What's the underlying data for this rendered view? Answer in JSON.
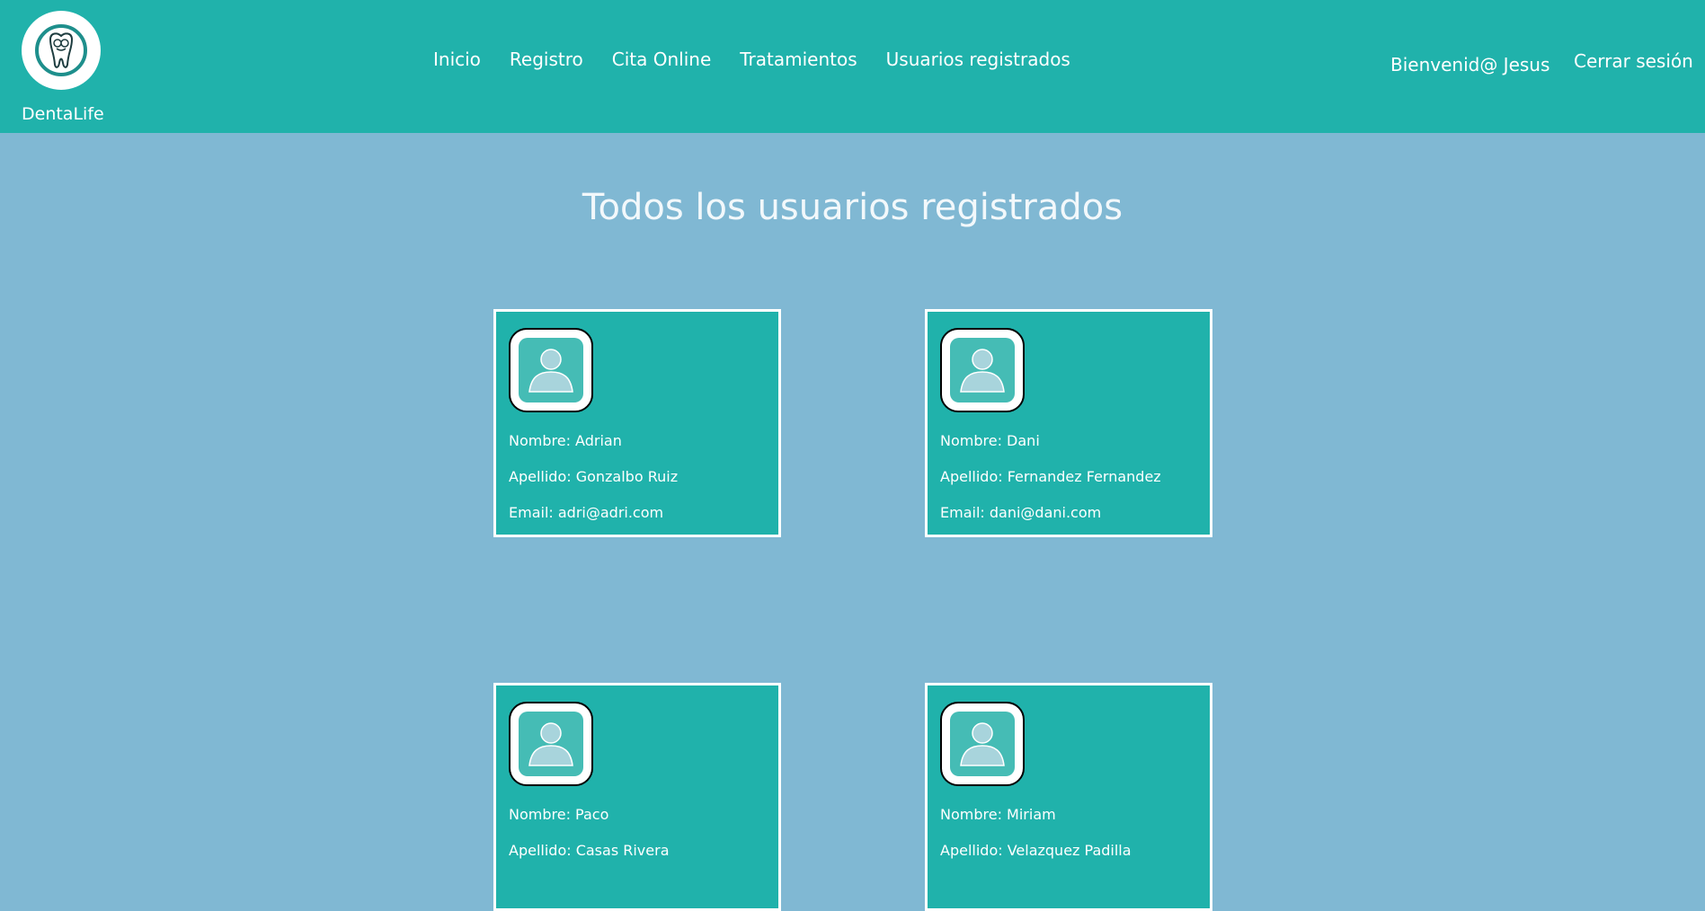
{
  "header": {
    "brand": "DentaLife",
    "nav": [
      "Inicio",
      "Registro",
      "Cita Online",
      "Tratamientos",
      "Usuarios registrados"
    ],
    "welcome": "Bienvenid@ Jesus",
    "logout": "Cerrar sesión"
  },
  "main": {
    "title": "Todos los usuarios registrados",
    "users": [
      {
        "nombre": "Nombre: Adrian",
        "apellido": "Apellido: Gonzalbo Ruiz",
        "email": "Email: adri@adri.com"
      },
      {
        "nombre": "Nombre: Dani",
        "apellido": "Apellido: Fernandez Fernandez",
        "email": "Email: dani@dani.com"
      },
      {
        "nombre": "Nombre: Paco",
        "apellido": "Apellido: Casas Rivera",
        "email": ""
      },
      {
        "nombre": "Nombre: Miriam",
        "apellido": "Apellido: Velazquez Padilla",
        "email": ""
      }
    ]
  },
  "colors": {
    "navbar": "#20b2ab",
    "background": "#80b8d3",
    "card": "#20b2ab"
  }
}
